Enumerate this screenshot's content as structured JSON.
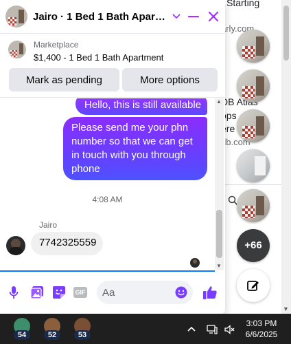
{
  "chat": {
    "title": "Jairo · 1 Bed 1 Bath Apartm...",
    "controls": {
      "dropdown": "chevron-down",
      "minimize": "minimize",
      "close": "close"
    },
    "accent": "#a033ff"
  },
  "product": {
    "label": "Marketplace",
    "title": "$1,400 - 1 Bed 1 Bath Apartment",
    "buttons": [
      "Mark as pending",
      "More options"
    ]
  },
  "messages": {
    "outgoing": [
      "Hello, this is still available",
      "Please send me your phn number so that we can get in touch with you through phone"
    ],
    "timestamp": "4:08 AM",
    "sender": "Jairo",
    "incoming": "7742325559"
  },
  "composer": {
    "placeholder": "Aa",
    "icons": [
      "microphone",
      "photo",
      "sticker",
      "gif",
      "emoji",
      "like"
    ],
    "gif_label": "GIF"
  },
  "background_page": {
    "fragments": [
      "Starting",
      "arly.com",
      "DB Atlas",
      "ops",
      "ere",
      "db.com"
    ]
  },
  "sidebar": {
    "more_count": "+66"
  },
  "taskbar": {
    "apps": [
      {
        "badge": "54"
      },
      {
        "badge": "52"
      },
      {
        "badge": "53"
      }
    ],
    "time": "3:03 PM",
    "date": "6/6/2025"
  }
}
